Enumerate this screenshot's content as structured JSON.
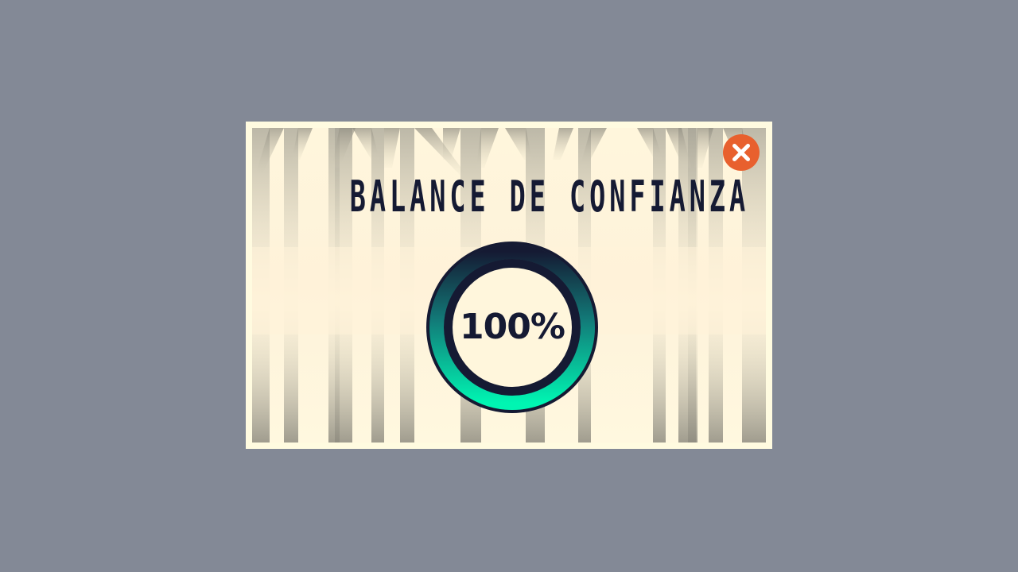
{
  "dialog": {
    "title": "BALANCE DE CONFIANZA",
    "close_icon": "close-x-icon"
  },
  "trust_gauge": {
    "value_label": "100%",
    "value": 100,
    "max": 100
  },
  "colors": {
    "backdrop": "#838996",
    "panel": "#fff6dc",
    "title_text": "#151a33",
    "close_button": "#e8602e",
    "gauge_outline": "#151a33",
    "gauge_fill_start": "#00f5b2",
    "gauge_fill_end": "#151a33"
  }
}
